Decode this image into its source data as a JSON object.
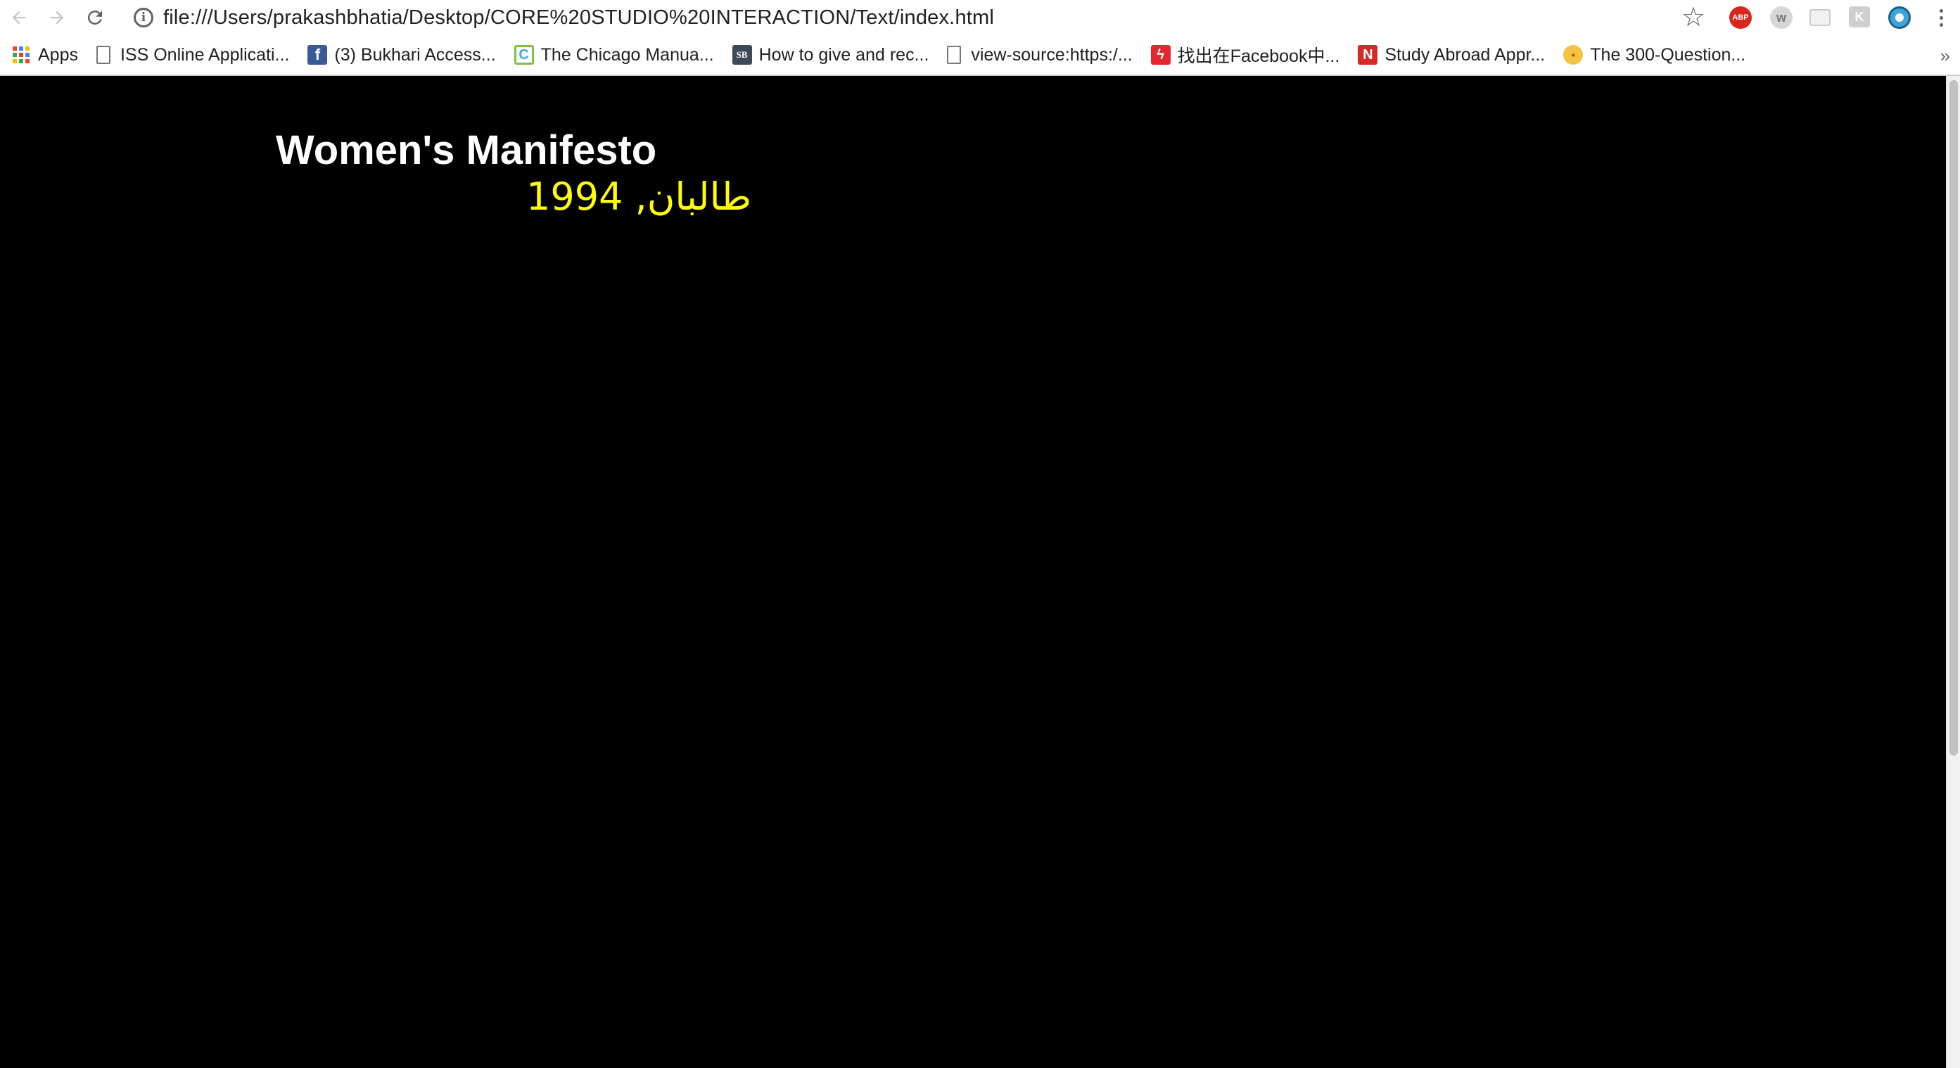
{
  "toolbar": {
    "back_icon": "arrow-left-icon",
    "forward_icon": "arrow-right-icon",
    "reload_icon": "reload-icon",
    "url": "file:///Users/prakashbhatia/Desktop/CORE%20STUDIO%20INTERACTION/Text/index.html",
    "extensions": [
      "adblock-plus-icon",
      "w-extension-icon",
      "blank-extension-icon",
      "k-extension-icon",
      "eye-extension-icon"
    ]
  },
  "bookmarks": [
    {
      "label": "Apps",
      "icon": "apps-grid-icon"
    },
    {
      "label": "ISS Online Applicati...",
      "icon": "page-icon"
    },
    {
      "label": "(3) Bukhari Access...",
      "icon": "facebook-icon"
    },
    {
      "label": "The Chicago Manua...",
      "icon": "chicago-manual-icon"
    },
    {
      "label": "How to give and rec...",
      "icon": "sb-icon"
    },
    {
      "label": "view-source:https:/...",
      "icon": "page-icon"
    },
    {
      "label": "找出在Facebook中...",
      "icon": "flash-icon"
    },
    {
      "label": "Study Abroad Appr...",
      "icon": "n-icon"
    },
    {
      "label": "The 300-Question...",
      "icon": "lightbulb-icon"
    }
  ],
  "page": {
    "title": "Women's Manifesto",
    "subtitle": "طالبان, 1994",
    "title_color": "#ffffff",
    "subtitle_color": "#ffff00",
    "background": "#000000"
  }
}
